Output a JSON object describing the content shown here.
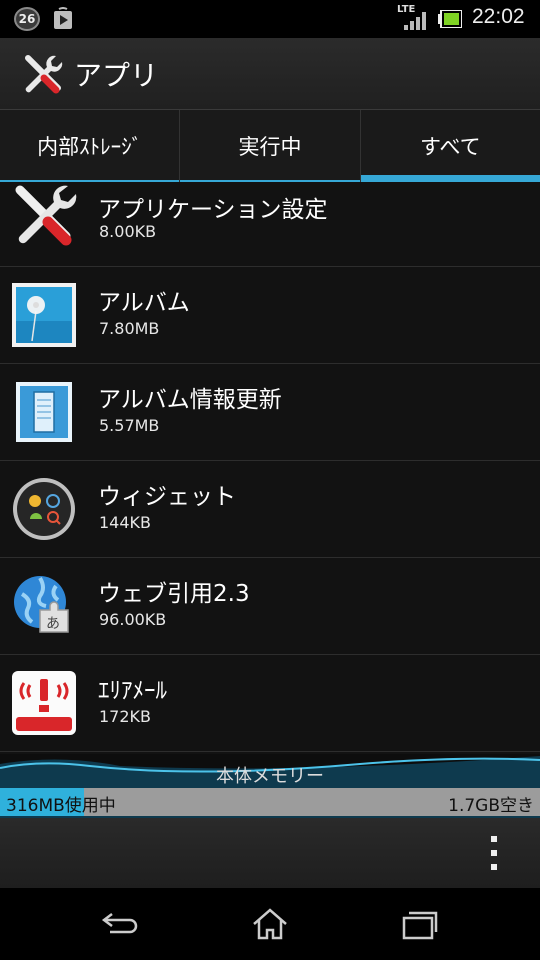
{
  "statusbar": {
    "notification_count": "26",
    "network": "LTE",
    "time": "22:02"
  },
  "actionbar": {
    "title": "アプリ",
    "icon": "tools-icon"
  },
  "tabs": [
    {
      "label": "内部ｽﾄﾚｰｼﾞ",
      "active": false
    },
    {
      "label": "実行中",
      "active": false
    },
    {
      "label": "すべて",
      "active": true
    }
  ],
  "apps": [
    {
      "name": "アプリケーション設定",
      "size": "8.00KB",
      "icon": "settings-tools-icon"
    },
    {
      "name": "アルバム",
      "size": "7.80MB",
      "icon": "album-icon"
    },
    {
      "name": "アルバム情報更新",
      "size": "5.57MB",
      "icon": "album-update-icon"
    },
    {
      "name": "ウィジェット",
      "size": "144KB",
      "icon": "widget-icon"
    },
    {
      "name": "ウェブ引用2.3",
      "size": "96.00KB",
      "icon": "web-quote-icon"
    },
    {
      "name": "ｴﾘｱﾒｰﾙ",
      "size": "172KB",
      "icon": "area-mail-icon"
    }
  ],
  "storage": {
    "title": "本体メモリー",
    "used_label": "316MB使用中",
    "free_label": "1.7GB空き",
    "used_fraction": 0.156
  },
  "colors": {
    "accent": "#36a8d6",
    "storage_used": "#2fb1dc"
  },
  "navbar": {
    "back": "back-icon",
    "home": "home-icon",
    "recents": "recents-icon"
  }
}
